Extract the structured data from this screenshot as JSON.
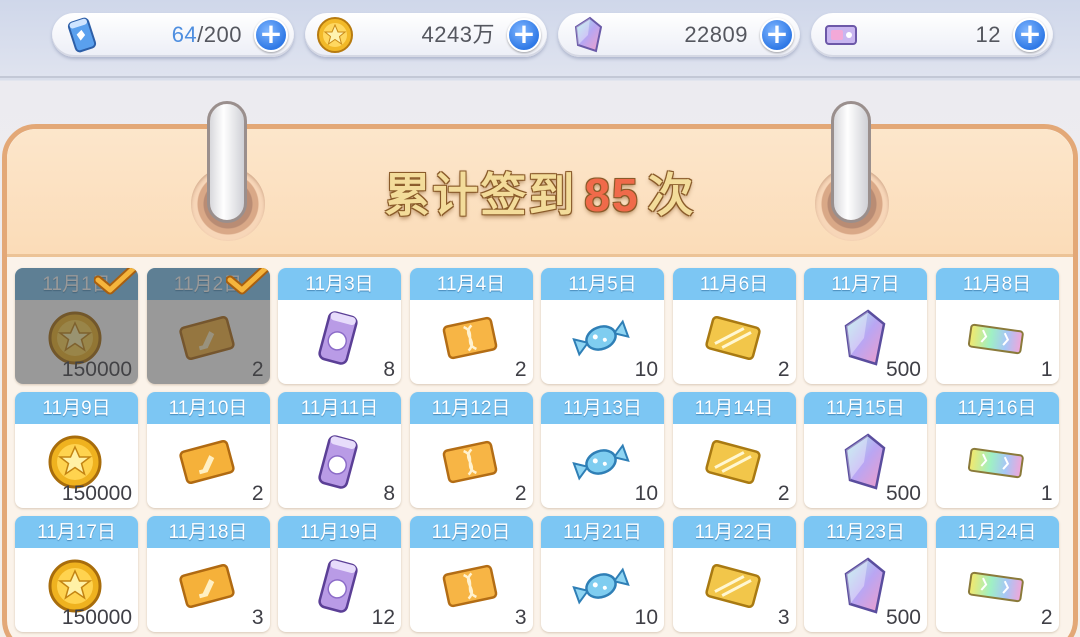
{
  "resources": [
    {
      "id": "stamina",
      "icon": "stamina-can-icon",
      "current": "64",
      "max": "/200"
    },
    {
      "id": "coins",
      "icon": "gold-coin-icon",
      "value": "4243万"
    },
    {
      "id": "gems",
      "icon": "crystal-gem-icon",
      "value": "22809"
    },
    {
      "id": "tickets",
      "icon": "ticket-icon",
      "value": "12"
    }
  ],
  "title": {
    "prefix": "累计签到",
    "count": "85",
    "suffix": "次"
  },
  "days": [
    {
      "date": "11月1日",
      "item": "coin",
      "qty": "150000",
      "claimed": true
    },
    {
      "date": "11月2日",
      "item": "orange-card",
      "qty": "2",
      "claimed": true
    },
    {
      "date": "11月3日",
      "item": "food-can",
      "qty": "8",
      "claimed": false
    },
    {
      "date": "11月4日",
      "item": "dna-card",
      "qty": "2",
      "claimed": false
    },
    {
      "date": "11月5日",
      "item": "candy",
      "qty": "10",
      "claimed": false
    },
    {
      "date": "11月6日",
      "item": "gold-card",
      "qty": "2",
      "claimed": false
    },
    {
      "date": "11月7日",
      "item": "crystal",
      "qty": "500",
      "claimed": false
    },
    {
      "date": "11月8日",
      "item": "rainbow-ticket",
      "qty": "1",
      "claimed": false
    },
    {
      "date": "11月9日",
      "item": "coin",
      "qty": "150000",
      "claimed": false
    },
    {
      "date": "11月10日",
      "item": "orange-card",
      "qty": "2",
      "claimed": false
    },
    {
      "date": "11月11日",
      "item": "food-can",
      "qty": "8",
      "claimed": false
    },
    {
      "date": "11月12日",
      "item": "dna-card",
      "qty": "2",
      "claimed": false
    },
    {
      "date": "11月13日",
      "item": "candy",
      "qty": "10",
      "claimed": false
    },
    {
      "date": "11月14日",
      "item": "gold-card",
      "qty": "2",
      "claimed": false
    },
    {
      "date": "11月15日",
      "item": "crystal",
      "qty": "500",
      "claimed": false
    },
    {
      "date": "11月16日",
      "item": "rainbow-ticket",
      "qty": "1",
      "claimed": false
    },
    {
      "date": "11月17日",
      "item": "coin",
      "qty": "150000",
      "claimed": false
    },
    {
      "date": "11月18日",
      "item": "orange-card",
      "qty": "3",
      "claimed": false
    },
    {
      "date": "11月19日",
      "item": "food-can",
      "qty": "12",
      "claimed": false
    },
    {
      "date": "11月20日",
      "item": "dna-card",
      "qty": "3",
      "claimed": false
    },
    {
      "date": "11月21日",
      "item": "candy",
      "qty": "10",
      "claimed": false
    },
    {
      "date": "11月22日",
      "item": "gold-card",
      "qty": "3",
      "claimed": false
    },
    {
      "date": "11月23日",
      "item": "crystal",
      "qty": "500",
      "claimed": false
    },
    {
      "date": "11月24日",
      "item": "rainbow-ticket",
      "qty": "2",
      "claimed": false
    }
  ]
}
